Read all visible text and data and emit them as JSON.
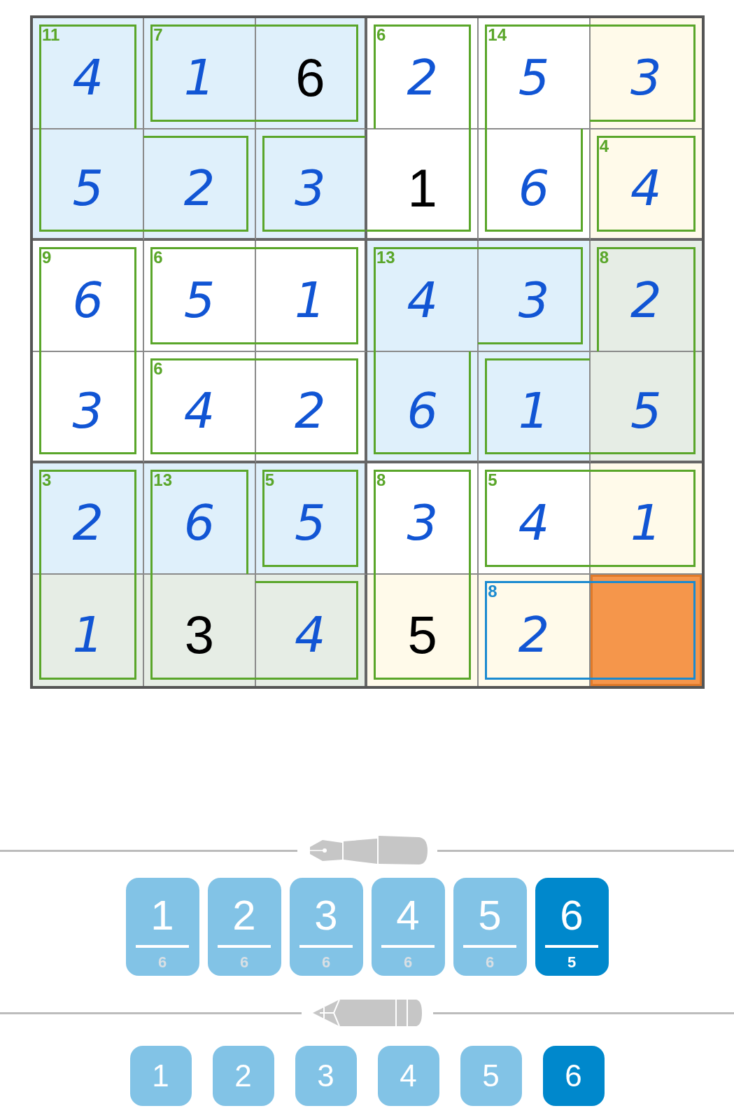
{
  "grid": {
    "rows": [
      {
        "cells": [
          {
            "digit": "4",
            "given": false,
            "color": "#dff0fb",
            "selected": false,
            "cage_sum": "11",
            "cage": {
              "top": true,
              "right": true,
              "bottom": false,
              "left": true
            },
            "cage_selected": false
          },
          {
            "digit": "1",
            "given": false,
            "color": "#dff0fb",
            "selected": false,
            "cage_sum": "7",
            "cage": {
              "top": true,
              "right": false,
              "bottom": true,
              "left": true
            },
            "cage_selected": false
          },
          {
            "digit": "6",
            "given": true,
            "color": "#dff0fb",
            "selected": false,
            "cage": {
              "top": true,
              "right": true,
              "bottom": true,
              "left": false
            },
            "cage_selected": false
          },
          {
            "digit": "2",
            "given": false,
            "color": "#ffffff",
            "selected": false,
            "cage_sum": "6",
            "cage": {
              "top": true,
              "right": true,
              "bottom": false,
              "left": true
            },
            "cage_selected": false
          },
          {
            "digit": "5",
            "given": false,
            "color": "#ffffff",
            "selected": false,
            "cage_sum": "14",
            "cage": {
              "top": true,
              "right": false,
              "bottom": false,
              "left": true
            },
            "cage_selected": false
          },
          {
            "digit": "3",
            "given": false,
            "color": "#fffaea",
            "selected": false,
            "cage": {
              "top": true,
              "right": true,
              "bottom": true,
              "left": false
            },
            "cage_selected": false
          }
        ]
      },
      {
        "cells": [
          {
            "digit": "5",
            "given": false,
            "color": "#dff0fb",
            "selected": false,
            "cage": {
              "top": false,
              "right": false,
              "bottom": true,
              "left": true
            },
            "cage_selected": false
          },
          {
            "digit": "2",
            "given": false,
            "color": "#dff0fb",
            "selected": false,
            "cage": {
              "top": true,
              "right": true,
              "bottom": true,
              "left": false
            },
            "cage_selected": false
          },
          {
            "digit": "3",
            "given": false,
            "color": "#dff0fb",
            "selected": false,
            "cage": {
              "top": true,
              "right": false,
              "bottom": true,
              "left": true
            },
            "cage_selected": false
          },
          {
            "digit": "1",
            "given": true,
            "color": "#ffffff",
            "selected": false,
            "cage": {
              "top": false,
              "right": true,
              "bottom": true,
              "left": false
            },
            "cage_selected": false
          },
          {
            "digit": "6",
            "given": false,
            "color": "#ffffff",
            "selected": false,
            "cage": {
              "top": false,
              "right": true,
              "bottom": true,
              "left": true
            },
            "cage_selected": false
          },
          {
            "digit": "4",
            "given": false,
            "color": "#fffaea",
            "selected": false,
            "cage_sum": "4",
            "cage": {
              "top": true,
              "right": true,
              "bottom": true,
              "left": true
            },
            "cage_selected": false
          }
        ]
      },
      {
        "cells": [
          {
            "digit": "6",
            "given": false,
            "color": "#ffffff",
            "selected": false,
            "cage_sum": "9",
            "cage": {
              "top": true,
              "right": true,
              "bottom": false,
              "left": true
            },
            "cage_selected": false
          },
          {
            "digit": "5",
            "given": false,
            "color": "#ffffff",
            "selected": false,
            "cage_sum": "6",
            "cage": {
              "top": true,
              "right": false,
              "bottom": true,
              "left": true
            },
            "cage_selected": false
          },
          {
            "digit": "1",
            "given": false,
            "color": "#ffffff",
            "selected": false,
            "cage": {
              "top": true,
              "right": true,
              "bottom": true,
              "left": false
            },
            "cage_selected": false
          },
          {
            "digit": "4",
            "given": false,
            "color": "#dff0fb",
            "selected": false,
            "cage_sum": "13",
            "cage": {
              "top": true,
              "right": false,
              "bottom": false,
              "left": true
            },
            "cage_selected": false
          },
          {
            "digit": "3",
            "given": false,
            "color": "#dff0fb",
            "selected": false,
            "cage": {
              "top": true,
              "right": true,
              "bottom": true,
              "left": false
            },
            "cage_selected": false
          },
          {
            "digit": "2",
            "given": false,
            "color": "#e6ede5",
            "selected": false,
            "cage_sum": "8",
            "cage": {
              "top": true,
              "right": true,
              "bottom": false,
              "left": true
            },
            "cage_selected": false
          }
        ]
      },
      {
        "cells": [
          {
            "digit": "3",
            "given": false,
            "color": "#ffffff",
            "selected": false,
            "cage": {
              "top": false,
              "right": true,
              "bottom": true,
              "left": true
            },
            "cage_selected": false
          },
          {
            "digit": "4",
            "given": false,
            "color": "#ffffff",
            "selected": false,
            "cage_sum": "6",
            "cage": {
              "top": true,
              "right": false,
              "bottom": true,
              "left": true
            },
            "cage_selected": false
          },
          {
            "digit": "2",
            "given": false,
            "color": "#ffffff",
            "selected": false,
            "cage": {
              "top": true,
              "right": true,
              "bottom": true,
              "left": false
            },
            "cage_selected": false
          },
          {
            "digit": "6",
            "given": false,
            "color": "#dff0fb",
            "selected": false,
            "cage": {
              "top": false,
              "right": true,
              "bottom": true,
              "left": true
            },
            "cage_selected": false
          },
          {
            "digit": "1",
            "given": false,
            "color": "#dff0fb",
            "selected": false,
            "cage": {
              "top": true,
              "right": false,
              "bottom": true,
              "left": true
            },
            "cage_selected": false
          },
          {
            "digit": "5",
            "given": false,
            "color": "#e6ede5",
            "selected": false,
            "cage": {
              "top": false,
              "right": true,
              "bottom": true,
              "left": false
            },
            "cage_selected": false
          }
        ]
      },
      {
        "cells": [
          {
            "digit": "2",
            "given": false,
            "color": "#dff0fb",
            "selected": false,
            "cage_sum": "3",
            "cage": {
              "top": true,
              "right": true,
              "bottom": false,
              "left": true
            },
            "cage_selected": false
          },
          {
            "digit": "6",
            "given": false,
            "color": "#dff0fb",
            "selected": false,
            "cage_sum": "13",
            "cage": {
              "top": true,
              "right": true,
              "bottom": false,
              "left": true
            },
            "cage_selected": false
          },
          {
            "digit": "5",
            "given": false,
            "color": "#dff0fb",
            "selected": false,
            "cage_sum": "5",
            "cage": {
              "top": true,
              "right": true,
              "bottom": true,
              "left": true
            },
            "cage_selected": false
          },
          {
            "digit": "3",
            "given": false,
            "color": "#ffffff",
            "selected": false,
            "cage_sum": "8",
            "cage": {
              "top": true,
              "right": true,
              "bottom": false,
              "left": true
            },
            "cage_selected": false
          },
          {
            "digit": "4",
            "given": false,
            "color": "#ffffff",
            "selected": false,
            "cage_sum": "5",
            "cage": {
              "top": true,
              "right": false,
              "bottom": true,
              "left": true
            },
            "cage_selected": false
          },
          {
            "digit": "1",
            "given": false,
            "color": "#fffaea",
            "selected": false,
            "cage": {
              "top": true,
              "right": true,
              "bottom": true,
              "left": false
            },
            "cage_selected": false
          }
        ]
      },
      {
        "cells": [
          {
            "digit": "1",
            "given": false,
            "color": "#e6ede5",
            "selected": false,
            "cage": {
              "top": false,
              "right": true,
              "bottom": true,
              "left": true
            },
            "cage_selected": false
          },
          {
            "digit": "3",
            "given": true,
            "color": "#e6ede5",
            "selected": false,
            "cage": {
              "top": false,
              "right": false,
              "bottom": true,
              "left": true
            },
            "cage_selected": false
          },
          {
            "digit": "4",
            "given": false,
            "color": "#e6ede5",
            "selected": false,
            "cage": {
              "top": true,
              "right": true,
              "bottom": true,
              "left": false
            },
            "cage_selected": false
          },
          {
            "digit": "5",
            "given": true,
            "color": "#fffaea",
            "selected": false,
            "cage": {
              "top": false,
              "right": true,
              "bottom": true,
              "left": true
            },
            "cage_selected": false
          },
          {
            "digit": "2",
            "given": false,
            "color": "#fffaea",
            "selected": false,
            "cage_sum": "8",
            "cage": {
              "top": true,
              "right": false,
              "bottom": true,
              "left": true
            },
            "cage_selected": true
          },
          {
            "color": "#f5964b",
            "selected": true,
            "cage": {
              "top": true,
              "right": true,
              "bottom": true,
              "left": false
            },
            "cage_selected": true
          }
        ]
      }
    ]
  },
  "pen_palette": {
    "buttons": [
      {
        "digit": "1",
        "count": "6",
        "selected": false
      },
      {
        "digit": "2",
        "count": "6",
        "selected": false
      },
      {
        "digit": "3",
        "count": "6",
        "selected": false
      },
      {
        "digit": "4",
        "count": "6",
        "selected": false
      },
      {
        "digit": "5",
        "count": "6",
        "selected": false
      },
      {
        "digit": "6",
        "count": "5",
        "selected": true
      }
    ]
  },
  "pencil_palette": {
    "buttons": [
      {
        "digit": "1",
        "selected": false
      },
      {
        "digit": "2",
        "selected": false
      },
      {
        "digit": "3",
        "selected": false
      },
      {
        "digit": "4",
        "selected": false
      },
      {
        "digit": "5",
        "selected": false
      },
      {
        "digit": "6",
        "selected": true
      }
    ]
  }
}
